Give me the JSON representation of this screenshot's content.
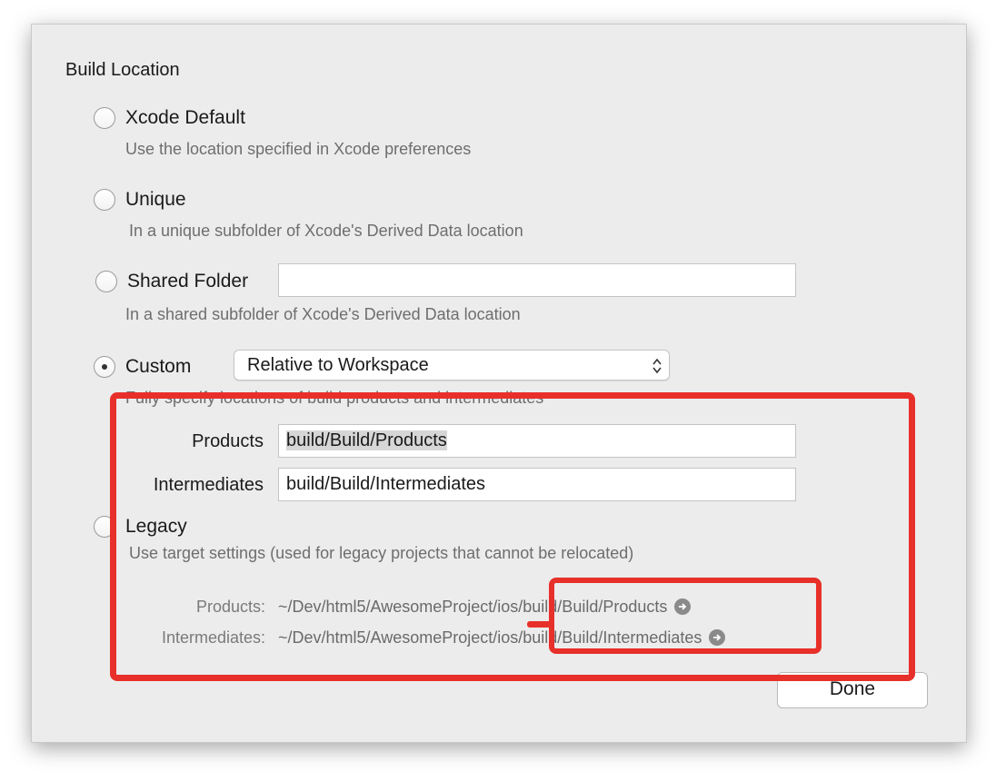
{
  "section_title": "Build Location",
  "options": {
    "xcode_default": {
      "label": "Xcode Default",
      "description": "Use the location specified in Xcode preferences"
    },
    "unique": {
      "label": "Unique",
      "description": "In a unique subfolder of Xcode's Derived Data location"
    },
    "shared_folder": {
      "label": "Shared Folder",
      "value": "",
      "description": "In a shared subfolder of Xcode's Derived Data location"
    },
    "custom": {
      "label": "Custom",
      "popup_value": "Relative to Workspace",
      "description": "Fully specify locations of build products and intermediates",
      "products_label": "Products",
      "products_value": "build/Build/Products",
      "intermediates_label": "Intermediates",
      "intermediates_value": "build/Build/Intermediates"
    },
    "legacy": {
      "label": "Legacy",
      "description": "Use target settings (used for legacy projects that cannot be relocated)"
    }
  },
  "resolved_paths": {
    "products_label": "Products:",
    "products_value": "~/Dev/html5/AwesomeProject/ios/build/Build/Products",
    "intermediates_label": "Intermediates:",
    "intermediates_value": "~/Dev/html5/AwesomeProject/ios/build/Build/Intermediates"
  },
  "done_button": "Done",
  "selected_option": "custom",
  "annotation_color": "#e8302a"
}
